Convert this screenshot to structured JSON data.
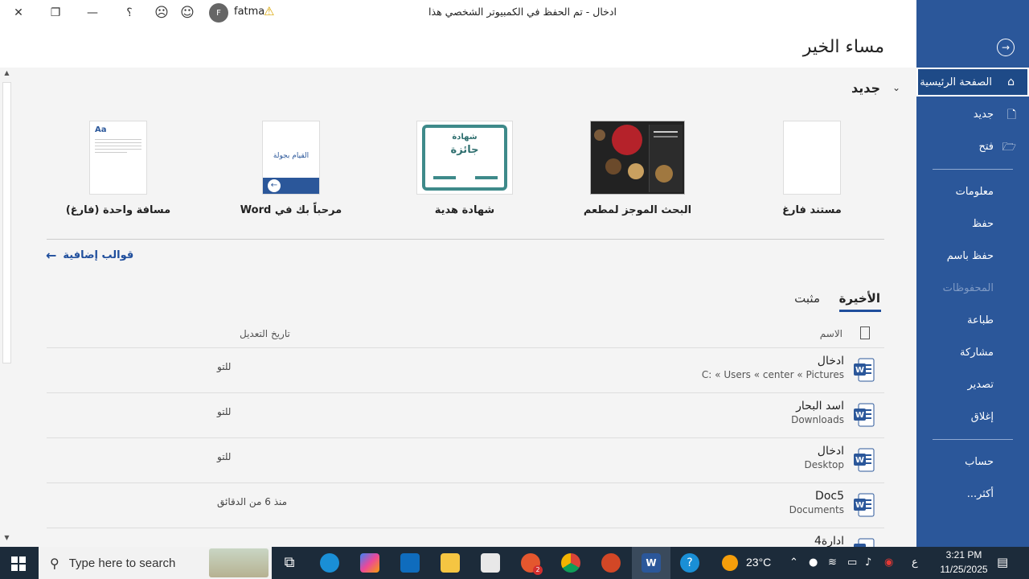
{
  "titlebar": {
    "doc_title": "ادخال  -  تم الحفظ في الكمبيوتر الشخصي هذا",
    "user_initial": "F",
    "user_name": "fatma",
    "help": "؟"
  },
  "greeting": "مساء الخير",
  "new_section": {
    "heading": "جديد",
    "templates": [
      {
        "label": "مستند فارغ"
      },
      {
        "label": "البحث الموجز لمطعم"
      },
      {
        "label": "شهادة هدية",
        "thumb_title": "شهادة",
        "thumb_sub": "جائزة"
      },
      {
        "label": "مرحباً بك في Word",
        "thumb_text": "القيام بجولة"
      },
      {
        "label": "مسافة واحدة (فارغ)",
        "thumb_text": "Aa"
      }
    ],
    "more_templates": "قوالب إضافية"
  },
  "tabs": {
    "recent": "الأخيرة",
    "pinned": "مثبت"
  },
  "columns": {
    "name": "الاسم",
    "modified": "تاريخ التعديل"
  },
  "files": [
    {
      "name": "ادخال",
      "path": "C: « Users « center « Pictures",
      "date": "للتو"
    },
    {
      "name": "اسد البحار",
      "path": "Downloads",
      "date": "للتو"
    },
    {
      "name": "ادخال",
      "path": "Desktop",
      "date": "للتو"
    },
    {
      "name": "Doc5",
      "path": "Documents",
      "date": "منذ 6 من الدقائق"
    },
    {
      "name": "ادارة4",
      "path": "",
      "date": ""
    }
  ],
  "sidebar": {
    "items": [
      {
        "label": "الصفحة الرئيسية"
      },
      {
        "label": "جديد"
      },
      {
        "label": "فتح"
      },
      {
        "label": "معلومات"
      },
      {
        "label": "حفظ"
      },
      {
        "label": "حفظ باسم"
      },
      {
        "label": "المحفوظات"
      },
      {
        "label": "طباعة"
      },
      {
        "label": "مشاركة"
      },
      {
        "label": "تصدير"
      },
      {
        "label": "إغلاق"
      },
      {
        "label": "حساب"
      },
      {
        "label": "أكثر..."
      }
    ]
  },
  "taskbar": {
    "search_placeholder": "Type here to search",
    "weather": "23°C",
    "time": "3:21 PM",
    "date": "11/25/2025",
    "lang": "ع",
    "zoom_badge": "2"
  },
  "colors": {
    "accent": "#2b579a",
    "taskbar": "#1c2b3a"
  }
}
